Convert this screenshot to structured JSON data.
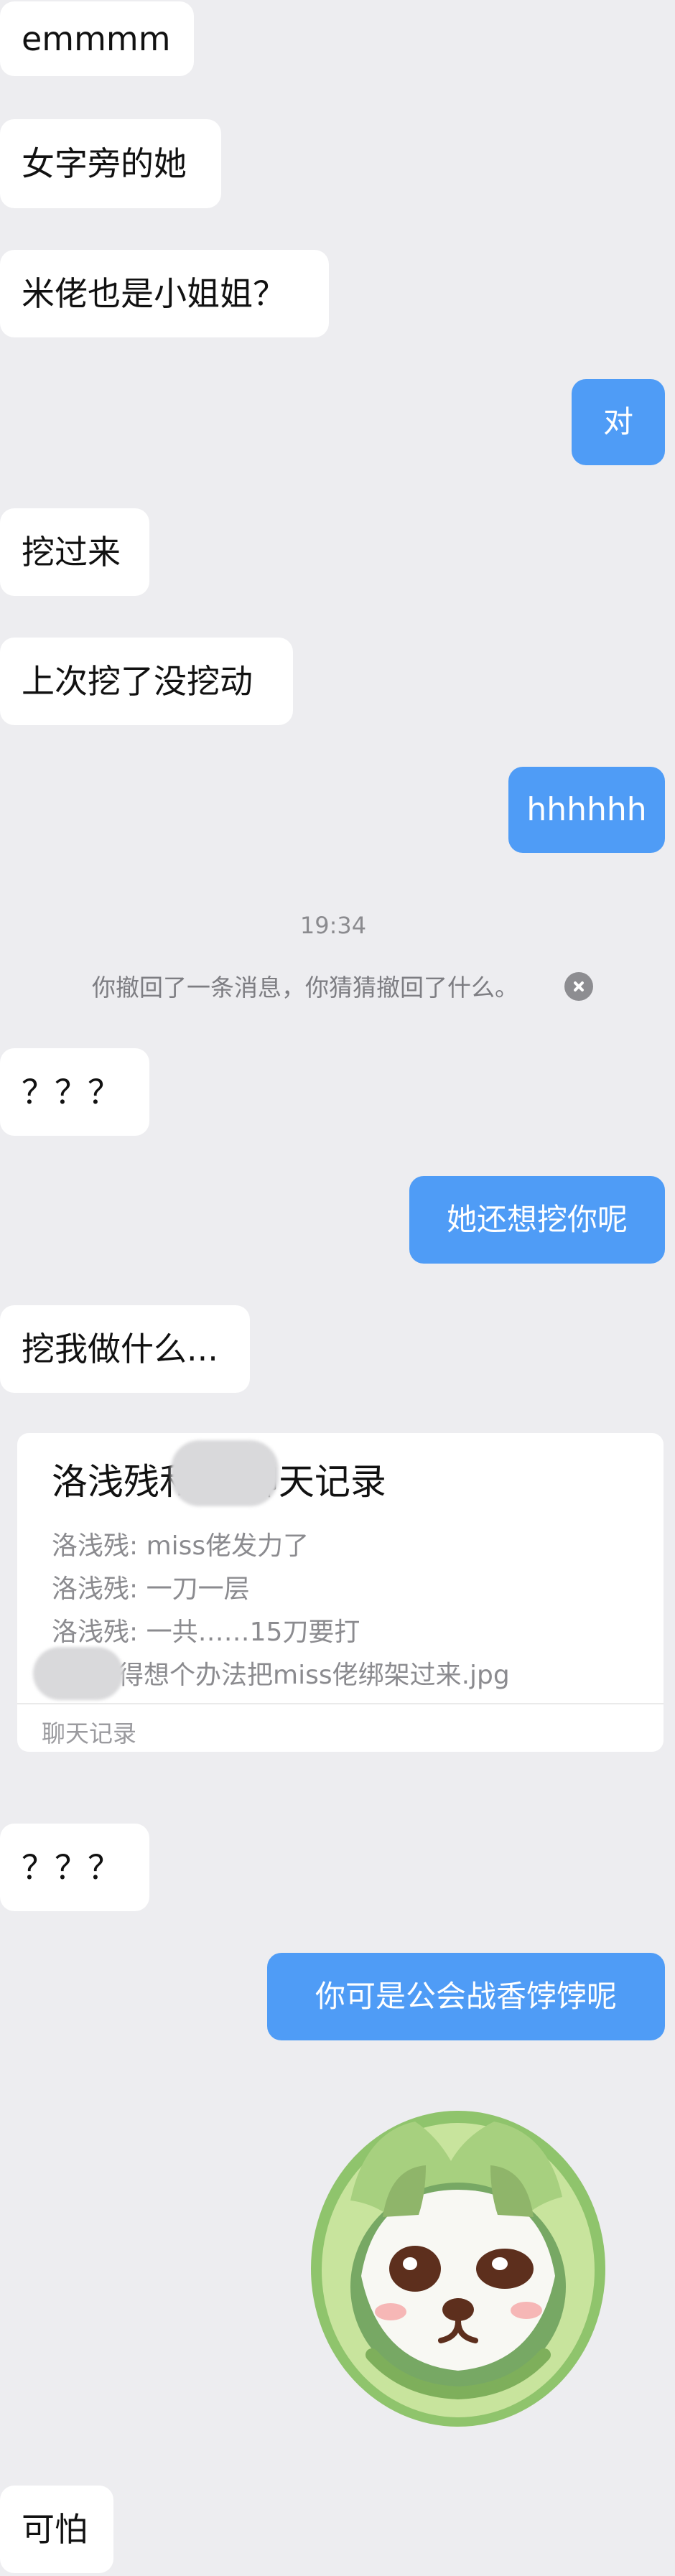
{
  "messages": {
    "m1": "emmmm",
    "m2": "女字旁的她",
    "m3": "米佬也是小姐姐？",
    "m4": "对",
    "m5": "挖过来",
    "m6": "上次挖了没挖动",
    "m7": "hhhhhh",
    "m8": "？？？",
    "m9": "她还想挖你呢",
    "m10": "挖我做什么...",
    "m11": "？？？",
    "m12": "你可是公会战香饽饽呢",
    "m13": "可怕"
  },
  "system": {
    "time": "19:34",
    "notice": "你撤回了一条消息，你猜猜撤回了什么。"
  },
  "record": {
    "title": "洛浅残和        的聊天记录",
    "lines": [
      "洛浅残: miss佬发力了",
      "洛浅残: 一刀一层",
      "洛浅残: 一共……15刀要打",
      "得想个办法把miss佬绑架过来.jpg"
    ],
    "footer": "聊天记录"
  },
  "colors": {
    "background": "#ededf0",
    "incoming_bubble": "#ffffff",
    "outgoing_bubble": "#4f9cf6",
    "sticker_body": "#b7d98a"
  },
  "icons": {
    "close": "close-icon"
  }
}
